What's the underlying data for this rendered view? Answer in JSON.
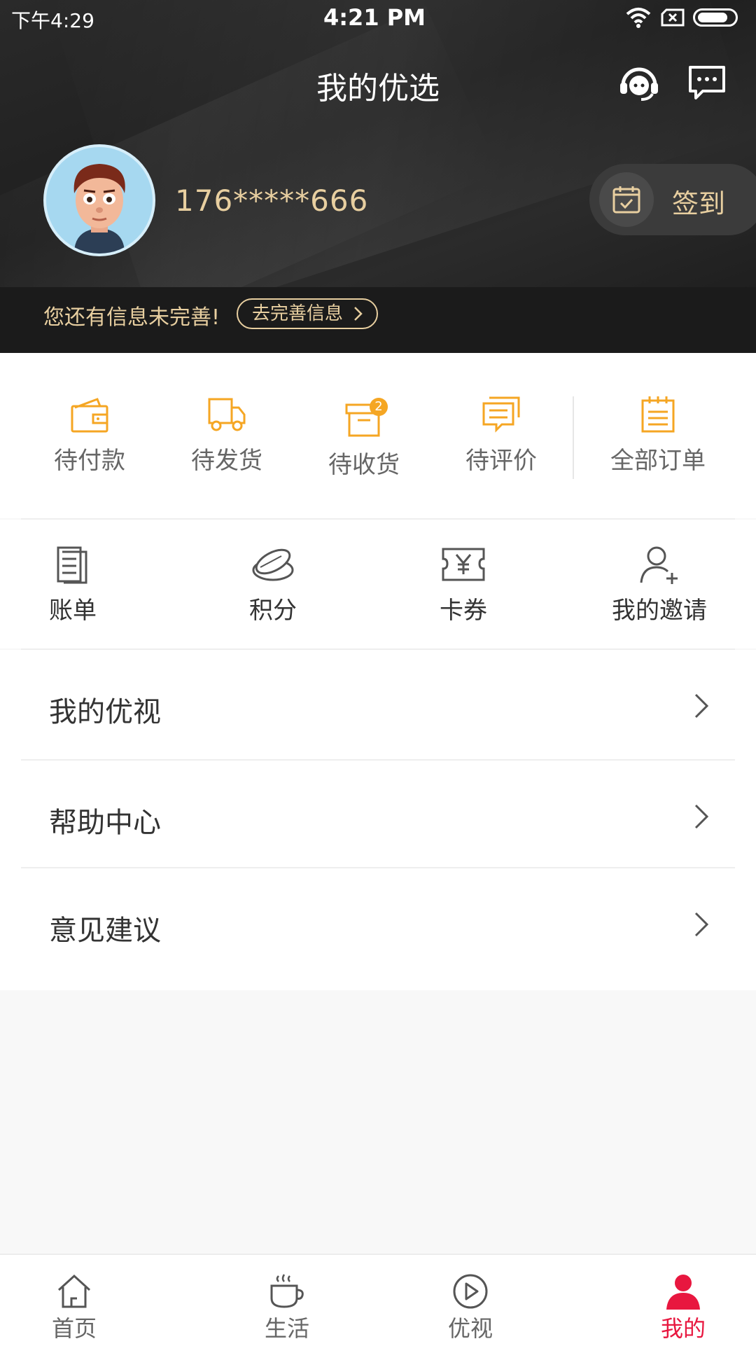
{
  "status_bar": {
    "left_time": "下午4:29",
    "center_time": "4:21 PM"
  },
  "header": {
    "title": "我的优选",
    "phone": "176*****666",
    "signin_label": "签到",
    "incomplete_text": "您还有信息未完善!",
    "complete_button": "去完善信息"
  },
  "orders": {
    "items": [
      {
        "label": "待付款",
        "icon": "wallet-icon"
      },
      {
        "label": "待发货",
        "icon": "truck-icon"
      },
      {
        "label": "待收货",
        "icon": "box-icon",
        "badge": "2"
      },
      {
        "label": "待评价",
        "icon": "comment-icon"
      }
    ],
    "all_orders": {
      "label": "全部订单",
      "icon": "clipboard-icon"
    }
  },
  "tools": [
    {
      "label": "账单",
      "icon": "bill-icon"
    },
    {
      "label": "积分",
      "icon": "coins-icon"
    },
    {
      "label": "卡券",
      "icon": "coupon-icon"
    },
    {
      "label": "我的邀请",
      "icon": "invite-icon"
    }
  ],
  "menu": [
    {
      "label": "我的优视"
    },
    {
      "label": "帮助中心"
    },
    {
      "label": "意见建议"
    }
  ],
  "tabbar": {
    "items": [
      {
        "label": "首页",
        "icon": "home-icon"
      },
      {
        "label": "生活",
        "icon": "cup-icon"
      },
      {
        "label": "优视",
        "icon": "play-icon"
      },
      {
        "label": "我的",
        "icon": "person-icon",
        "active": true
      }
    ]
  },
  "colors": {
    "accent_gold": "#f5a623",
    "header_text_gold": "#e8cfa0",
    "active_tab_red": "#e8173f"
  }
}
